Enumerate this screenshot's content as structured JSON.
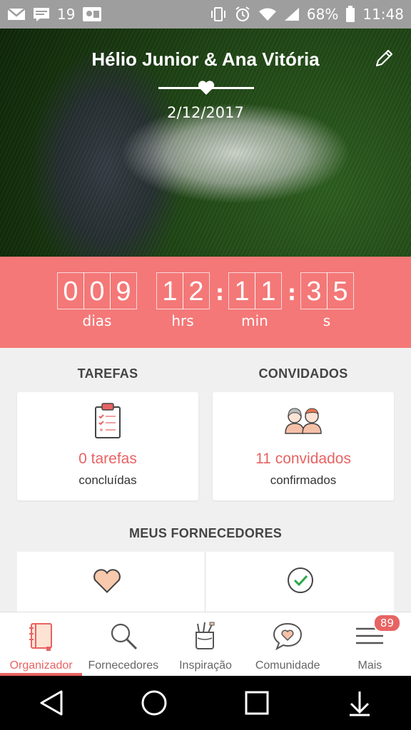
{
  "status_bar": {
    "left_icons": [
      "gmail-icon",
      "message-icon",
      "notification-19-icon",
      "photo-icon"
    ],
    "notification_count": "19",
    "battery": "68%",
    "time": "11:48",
    "right_icons": [
      "vibrate-icon",
      "alarm-icon",
      "wifi-icon",
      "signal-icon",
      "battery-icon"
    ]
  },
  "hero": {
    "title": "Hélio Junior & Ana Vitória",
    "date": "2/12/2017"
  },
  "countdown": {
    "days": "009",
    "hours": "12",
    "minutes": "11",
    "seconds": "35",
    "label_days": "dias",
    "label_hours": "hrs",
    "label_minutes": "min",
    "label_seconds": "s",
    "colon": ":"
  },
  "tasks": {
    "heading": "TAREFAS",
    "main": "0 tarefas",
    "sub": "concluídas",
    "icon": "clipboard-checklist-icon"
  },
  "guests": {
    "heading": "CONVIDADOS",
    "main": "11 convidados",
    "sub": "confirmados",
    "icon": "couple-icon"
  },
  "vendors": {
    "heading": "MEUS FORNECEDORES",
    "left_icon": "heart-icon",
    "right_icon": "check-circle-icon"
  },
  "bottom_nav": {
    "items": [
      {
        "label": "Organizador",
        "icon": "notebook-icon",
        "active": true
      },
      {
        "label": "Fornecedores",
        "icon": "search-icon",
        "active": false
      },
      {
        "label": "Inspiração",
        "icon": "cup-icon",
        "active": false
      },
      {
        "label": "Comunidade",
        "icon": "chat-heart-icon",
        "active": false
      },
      {
        "label": "Mais",
        "icon": "menu-icon",
        "active": false
      }
    ],
    "more_badge": "89"
  },
  "colors": {
    "accent": "#e86363",
    "countdown_bg": "#f47878",
    "status_bar": "#9e9e9e"
  }
}
